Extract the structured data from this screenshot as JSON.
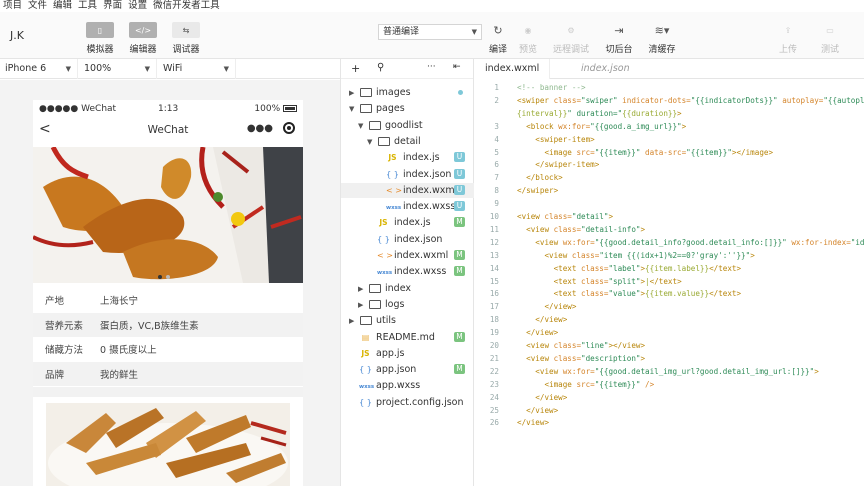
{
  "menu": [
    "项目",
    "文件",
    "编辑",
    "工具",
    "界面",
    "设置",
    "微信开发者工具"
  ],
  "toolbar": {
    "avatar": "J.K",
    "simulator": "模拟器",
    "editor": "编辑器",
    "debugger": "调试器",
    "compile_mode": "普通编译",
    "compile": "编译",
    "preview": "预览",
    "remote_debug": "远程调试",
    "background": "切后台",
    "clear_cache": "清缓存",
    "upload": "上传",
    "test": "测试"
  },
  "device": {
    "model": "iPhone 6",
    "zoom": "100%",
    "network": "WiFi"
  },
  "phone": {
    "carrier": "●●●●● WeChat",
    "time": "1:13",
    "battery": "100%",
    "nav_title": "WeChat",
    "detail_info": [
      {
        "label": "产地",
        "split": "|",
        "value": "上海长宁"
      },
      {
        "label": "营养元素",
        "split": "|",
        "value": "蛋白质，VC,B族维生素"
      },
      {
        "label": "储藏方法",
        "split": "|",
        "value": "0 摄氏度以上"
      },
      {
        "label": "品牌",
        "split": "|",
        "value": "我的鲜生"
      }
    ]
  },
  "tree": {
    "items": [
      {
        "name": "images",
        "type": "folder",
        "depth": 0,
        "open": false
      },
      {
        "name": "pages",
        "type": "folder",
        "depth": 0,
        "open": true
      },
      {
        "name": "goodlist",
        "type": "folder",
        "depth": 1,
        "open": true
      },
      {
        "name": "detail",
        "type": "folder",
        "depth": 2,
        "open": true
      },
      {
        "name": "index.js",
        "type": "js",
        "depth": 3,
        "badge": "U"
      },
      {
        "name": "index.json",
        "type": "json",
        "depth": 3,
        "badge": "U"
      },
      {
        "name": "index.wxml",
        "type": "wxml",
        "depth": 3,
        "badge": "U"
      },
      {
        "name": "index.wxss",
        "type": "wxss",
        "depth": 3,
        "badge": "U"
      },
      {
        "name": "index.js",
        "type": "js",
        "depth": 2,
        "badge": "M"
      },
      {
        "name": "index.json",
        "type": "json",
        "depth": 2
      },
      {
        "name": "index.wxml",
        "type": "wxml",
        "depth": 2,
        "badge": "M"
      },
      {
        "name": "index.wxss",
        "type": "wxss",
        "depth": 2,
        "badge": "M"
      },
      {
        "name": "index",
        "type": "folder",
        "depth": 1,
        "open": false
      },
      {
        "name": "logs",
        "type": "folder",
        "depth": 1,
        "open": false
      },
      {
        "name": "utils",
        "type": "folder",
        "depth": 0,
        "open": false
      },
      {
        "name": "README.md",
        "type": "md",
        "depth": 0,
        "badge": "M"
      },
      {
        "name": "app.js",
        "type": "js",
        "depth": 0
      },
      {
        "name": "app.json",
        "type": "json",
        "depth": 0,
        "badge": "M"
      },
      {
        "name": "app.wxss",
        "type": "wxss",
        "depth": 0
      },
      {
        "name": "project.config.json",
        "type": "json",
        "depth": 0
      }
    ]
  },
  "editor": {
    "tabs": [
      "index.wxml",
      "index.json"
    ],
    "lines": [
      "<!-- banner -->",
      "<swiper class=\"swiper\" indicator-dots=\"{{indicatorDots}}\" autoplay=\"{{autoplay}}\"",
      "{interval}}\" duration=\"{{duration}}\">",
      "  <block wx:for=\"{{good.a_img_url}}\">",
      "    <swiper-item>",
      "      <image src=\"{{item}}\" data-src=\"{{item}}\"></image>",
      "    </swiper-item>",
      "  </block>",
      "</swiper>",
      "",
      "<view class=\"detail\">",
      "  <view class=\"detail-info\">",
      "    <view wx:for=\"{{good.detail_info?good.detail_info:[]}}\" wx:for-index=\"idx\"",
      "      <view class=\"item {{(idx+1)%2==0?'gray':''}}\">",
      "        <text class=\"label\">{{item.label}}</text>",
      "        <text class=\"split\">|</text>",
      "        <text class=\"value\">{{item.value}}</text>",
      "      </view>",
      "    </view>",
      "  </view>",
      "  <view class=\"line\"></view>",
      "  <view class=\"description\">",
      "    <view wx:for=\"{{good.detail_img_url?good.detail_img_url:[]}}\">",
      "      <image src=\"{{item}}\" />",
      "    </view>",
      "  </view>",
      "</view>"
    ]
  }
}
